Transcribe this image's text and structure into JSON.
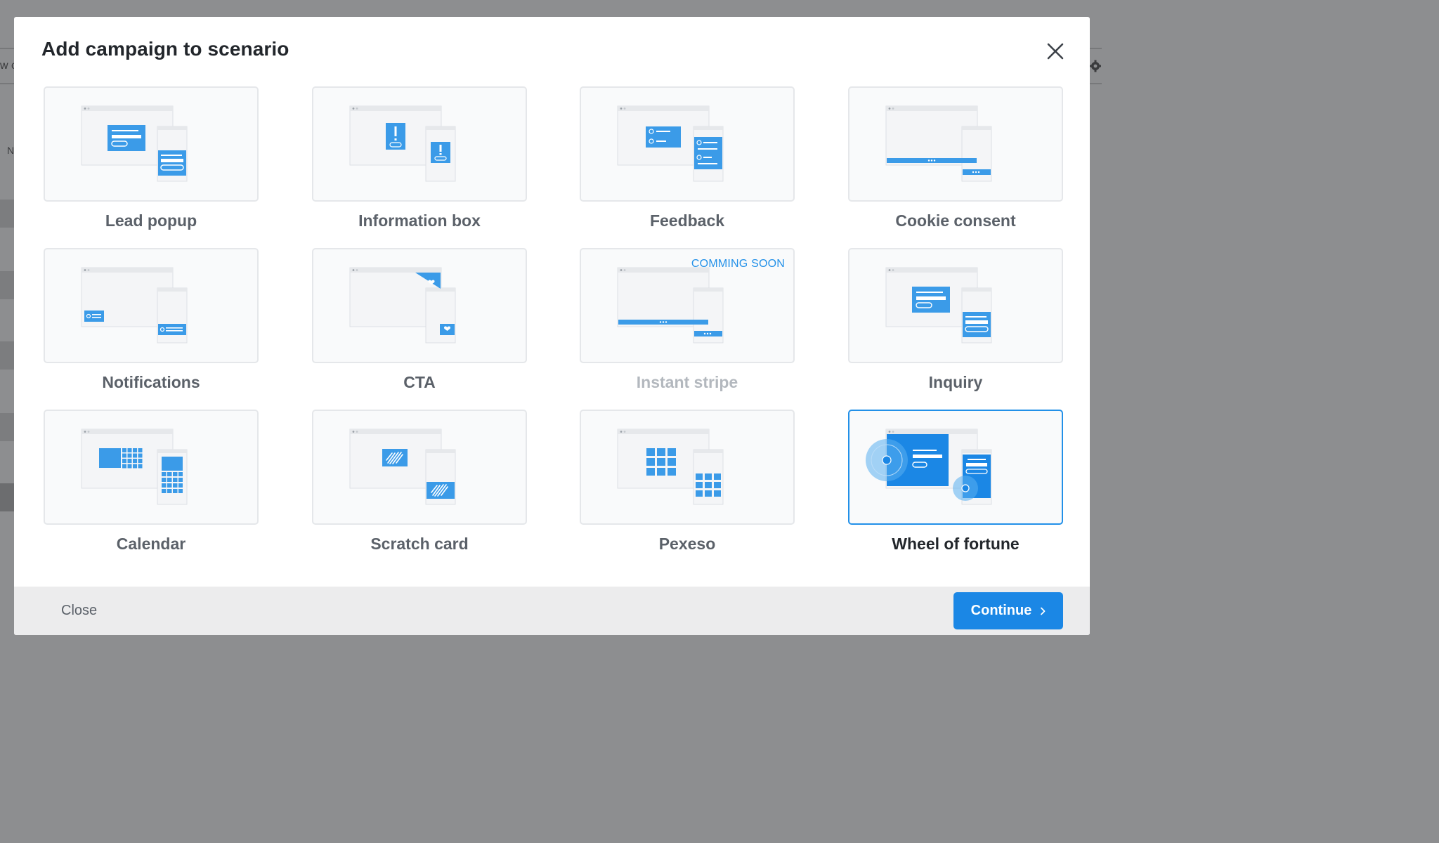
{
  "background": {
    "fragments": [
      "w c",
      "N"
    ]
  },
  "modal": {
    "title": "Add campaign to scenario",
    "close_icon": "close-icon"
  },
  "cards": [
    {
      "label": "Lead popup",
      "illustration": "lead-popup",
      "state": "normal"
    },
    {
      "label": "Information box",
      "illustration": "information-box",
      "state": "normal"
    },
    {
      "label": "Feedback",
      "illustration": "feedback",
      "state": "normal"
    },
    {
      "label": "Cookie consent",
      "illustration": "cookie-consent",
      "state": "normal"
    },
    {
      "label": "Notifications",
      "illustration": "notifications",
      "state": "normal"
    },
    {
      "label": "CTA",
      "illustration": "cta",
      "state": "normal"
    },
    {
      "label": "Instant stripe",
      "illustration": "instant-stripe",
      "state": "disabled",
      "badge": "COMMING SOON"
    },
    {
      "label": "Inquiry",
      "illustration": "inquiry",
      "state": "normal"
    },
    {
      "label": "Calendar",
      "illustration": "calendar",
      "state": "normal"
    },
    {
      "label": "Scratch card",
      "illustration": "scratch-card",
      "state": "normal"
    },
    {
      "label": "Pexeso",
      "illustration": "pexeso",
      "state": "normal"
    },
    {
      "label": "Wheel of fortune",
      "illustration": "wheel-of-fortune",
      "state": "selected"
    }
  ],
  "footer": {
    "close_label": "Close",
    "continue_label": "Continue",
    "continue_icon": "chevron-right-icon"
  },
  "colors": {
    "accent": "#1b87e5",
    "illustration_blue": "#3b9be8",
    "selected_border": "#2290e8",
    "title": "#22262b",
    "label": "#5b6169",
    "disabled_label": "#b3b8be",
    "footer_bg": "#ececed"
  }
}
